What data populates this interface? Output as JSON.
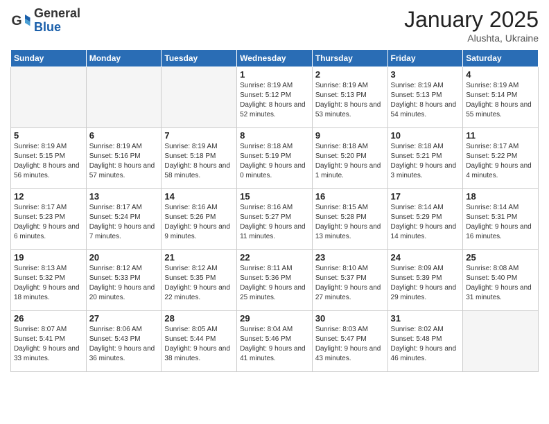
{
  "header": {
    "logo_general": "General",
    "logo_blue": "Blue",
    "month_title": "January 2025",
    "subtitle": "Alushta, Ukraine"
  },
  "weekdays": [
    "Sunday",
    "Monday",
    "Tuesday",
    "Wednesday",
    "Thursday",
    "Friday",
    "Saturday"
  ],
  "weeks": [
    [
      {
        "day": "",
        "empty": true
      },
      {
        "day": "",
        "empty": true
      },
      {
        "day": "",
        "empty": true
      },
      {
        "day": "1",
        "info": "Sunrise: 8:19 AM\nSunset: 5:12 PM\nDaylight: 8 hours\nand 52 minutes."
      },
      {
        "day": "2",
        "info": "Sunrise: 8:19 AM\nSunset: 5:13 PM\nDaylight: 8 hours\nand 53 minutes."
      },
      {
        "day": "3",
        "info": "Sunrise: 8:19 AM\nSunset: 5:13 PM\nDaylight: 8 hours\nand 54 minutes."
      },
      {
        "day": "4",
        "info": "Sunrise: 8:19 AM\nSunset: 5:14 PM\nDaylight: 8 hours\nand 55 minutes."
      }
    ],
    [
      {
        "day": "5",
        "info": "Sunrise: 8:19 AM\nSunset: 5:15 PM\nDaylight: 8 hours\nand 56 minutes."
      },
      {
        "day": "6",
        "info": "Sunrise: 8:19 AM\nSunset: 5:16 PM\nDaylight: 8 hours\nand 57 minutes."
      },
      {
        "day": "7",
        "info": "Sunrise: 8:19 AM\nSunset: 5:18 PM\nDaylight: 8 hours\nand 58 minutes."
      },
      {
        "day": "8",
        "info": "Sunrise: 8:18 AM\nSunset: 5:19 PM\nDaylight: 9 hours\nand 0 minutes."
      },
      {
        "day": "9",
        "info": "Sunrise: 8:18 AM\nSunset: 5:20 PM\nDaylight: 9 hours\nand 1 minute."
      },
      {
        "day": "10",
        "info": "Sunrise: 8:18 AM\nSunset: 5:21 PM\nDaylight: 9 hours\nand 3 minutes."
      },
      {
        "day": "11",
        "info": "Sunrise: 8:17 AM\nSunset: 5:22 PM\nDaylight: 9 hours\nand 4 minutes."
      }
    ],
    [
      {
        "day": "12",
        "info": "Sunrise: 8:17 AM\nSunset: 5:23 PM\nDaylight: 9 hours\nand 6 minutes."
      },
      {
        "day": "13",
        "info": "Sunrise: 8:17 AM\nSunset: 5:24 PM\nDaylight: 9 hours\nand 7 minutes."
      },
      {
        "day": "14",
        "info": "Sunrise: 8:16 AM\nSunset: 5:26 PM\nDaylight: 9 hours\nand 9 minutes."
      },
      {
        "day": "15",
        "info": "Sunrise: 8:16 AM\nSunset: 5:27 PM\nDaylight: 9 hours\nand 11 minutes."
      },
      {
        "day": "16",
        "info": "Sunrise: 8:15 AM\nSunset: 5:28 PM\nDaylight: 9 hours\nand 13 minutes."
      },
      {
        "day": "17",
        "info": "Sunrise: 8:14 AM\nSunset: 5:29 PM\nDaylight: 9 hours\nand 14 minutes."
      },
      {
        "day": "18",
        "info": "Sunrise: 8:14 AM\nSunset: 5:31 PM\nDaylight: 9 hours\nand 16 minutes."
      }
    ],
    [
      {
        "day": "19",
        "info": "Sunrise: 8:13 AM\nSunset: 5:32 PM\nDaylight: 9 hours\nand 18 minutes."
      },
      {
        "day": "20",
        "info": "Sunrise: 8:12 AM\nSunset: 5:33 PM\nDaylight: 9 hours\nand 20 minutes."
      },
      {
        "day": "21",
        "info": "Sunrise: 8:12 AM\nSunset: 5:35 PM\nDaylight: 9 hours\nand 22 minutes."
      },
      {
        "day": "22",
        "info": "Sunrise: 8:11 AM\nSunset: 5:36 PM\nDaylight: 9 hours\nand 25 minutes."
      },
      {
        "day": "23",
        "info": "Sunrise: 8:10 AM\nSunset: 5:37 PM\nDaylight: 9 hours\nand 27 minutes."
      },
      {
        "day": "24",
        "info": "Sunrise: 8:09 AM\nSunset: 5:39 PM\nDaylight: 9 hours\nand 29 minutes."
      },
      {
        "day": "25",
        "info": "Sunrise: 8:08 AM\nSunset: 5:40 PM\nDaylight: 9 hours\nand 31 minutes."
      }
    ],
    [
      {
        "day": "26",
        "info": "Sunrise: 8:07 AM\nSunset: 5:41 PM\nDaylight: 9 hours\nand 33 minutes."
      },
      {
        "day": "27",
        "info": "Sunrise: 8:06 AM\nSunset: 5:43 PM\nDaylight: 9 hours\nand 36 minutes."
      },
      {
        "day": "28",
        "info": "Sunrise: 8:05 AM\nSunset: 5:44 PM\nDaylight: 9 hours\nand 38 minutes."
      },
      {
        "day": "29",
        "info": "Sunrise: 8:04 AM\nSunset: 5:46 PM\nDaylight: 9 hours\nand 41 minutes."
      },
      {
        "day": "30",
        "info": "Sunrise: 8:03 AM\nSunset: 5:47 PM\nDaylight: 9 hours\nand 43 minutes."
      },
      {
        "day": "31",
        "info": "Sunrise: 8:02 AM\nSunset: 5:48 PM\nDaylight: 9 hours\nand 46 minutes."
      },
      {
        "day": "",
        "empty": true
      }
    ]
  ]
}
